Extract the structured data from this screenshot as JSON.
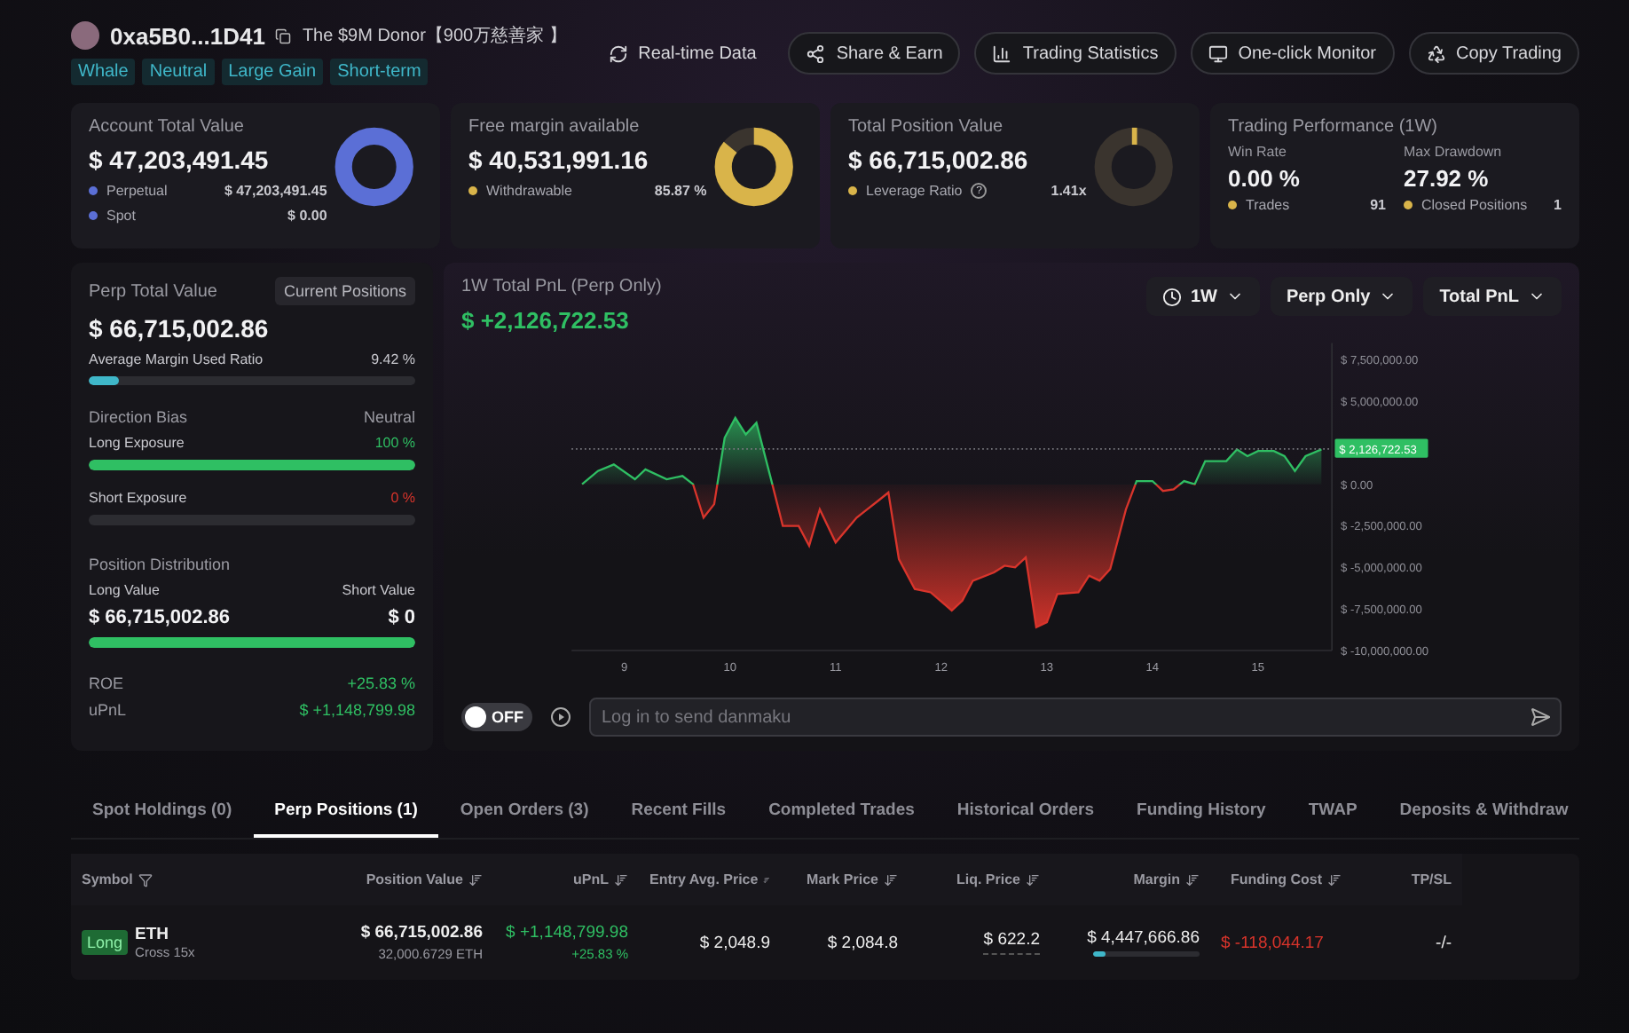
{
  "header": {
    "address": "0xa5B0...1D41",
    "nickname": "The $9M Donor【900万慈善家 】",
    "tags": [
      "Whale",
      "Neutral",
      "Large Gain",
      "Short-term"
    ],
    "actions": [
      {
        "label": "Real-time Data",
        "kind": "refresh",
        "framed": false
      },
      {
        "label": "Share & Earn",
        "kind": "share",
        "framed": true
      },
      {
        "label": "Trading Statistics",
        "kind": "stats",
        "framed": true
      },
      {
        "label": "One-click Monitor",
        "kind": "monitor",
        "framed": true
      },
      {
        "label": "Copy Trading",
        "kind": "copy",
        "framed": true
      }
    ]
  },
  "summary_cards": [
    {
      "kind": "donut",
      "title": "Account Total Value",
      "value": "$ 47,203,491.45",
      "color": "#5b6fd6",
      "rows": [
        {
          "label": "Perpetual",
          "value": "$ 47,203,491.45",
          "color": "#5b6fd6"
        },
        {
          "label": "Spot",
          "value": "$ 0.00",
          "color": "#5b6fd6"
        }
      ]
    },
    {
      "kind": "donut",
      "title": "Free margin available",
      "value": "$ 40,531,991.16",
      "color": "#d9b44a",
      "level": 0.8587,
      "rows": [
        {
          "label": "Withdrawable",
          "value": "85.87 %",
          "color": "#d9b44a"
        }
      ]
    },
    {
      "kind": "gauge",
      "title": "Total Position Value",
      "value": "$ 66,715,002.86",
      "color": "#d9b44a",
      "rows": [
        {
          "label": "Leverage Ratio",
          "value": "1.41x",
          "color": "#d9b44a",
          "help": "?"
        }
      ]
    },
    {
      "kind": "performance",
      "title": "Trading Performance (1W)",
      "stats": [
        {
          "label": "Win Rate",
          "value": "0.00 %"
        },
        {
          "label": "Max Drawdown",
          "value": "27.92 %"
        }
      ],
      "rows": [
        {
          "label": "Trades",
          "value": "91",
          "color": "#d9b44a"
        },
        {
          "label": "Closed Positions",
          "value": "1",
          "color": "#d9b44a"
        }
      ]
    }
  ],
  "perp_panel": {
    "title": "Perp Total Value",
    "button": "Current Positions",
    "value": "$ 66,715,002.86",
    "margin": {
      "label": "Average Margin Used Ratio",
      "reading": "9.42 %",
      "level": 0.0942
    },
    "bias": {
      "title": "Direction Bias",
      "reading": "Neutral",
      "bars": [
        {
          "label": "Long Exposure",
          "reading": "100 %",
          "level": 1,
          "color": "#2fbf63"
        },
        {
          "label": "Short Exposure",
          "reading": "0 %",
          "color": "#d9342b"
        }
      ]
    },
    "distribution": {
      "title": "Position Distribution",
      "long_label": "Long Value",
      "short_label": "Short Value",
      "long_value": "$ 66,715,002.86",
      "short_value": "$ 0",
      "level": 1
    },
    "metrics": [
      {
        "label": "ROE",
        "value": "+25.83 %"
      },
      {
        "label": "uPnL",
        "value": "$ +1,148,799.98"
      }
    ]
  },
  "pnl_panel": {
    "title": "1W Total PnL (Perp Only)",
    "value": "$ +2,126,722.53",
    "filters": [
      {
        "label": "1W",
        "icon": true
      },
      {
        "label": "Perp Only",
        "icon": false
      },
      {
        "label": "Total PnL",
        "icon": false
      }
    ],
    "chart_data": {
      "type": "area",
      "ref_lines": [
        {
          "axis": "y",
          "value": 2126722.53,
          "label": "$ 2,126,722.53",
          "color": "#7a7a80"
        }
      ],
      "xlim": [
        8.5,
        15.7
      ],
      "ylim": [
        -10000000,
        8500000
      ],
      "xticks": [
        9,
        10,
        11,
        12,
        13,
        14,
        15
      ],
      "yticks": [
        {
          "value": 7500000,
          "label": "$ 7,500,000.00"
        },
        {
          "value": 5000000,
          "label": "$ 5,000,000.00"
        },
        {
          "value": 0,
          "label": "$ 0.00"
        },
        {
          "value": -2500000,
          "label": "$ -2,500,000.00"
        },
        {
          "value": -5000000,
          "label": "$ -5,000,000.00"
        },
        {
          "value": -7500000,
          "label": "$ -7,500,000.00"
        },
        {
          "value": -10000000,
          "label": "$ -10,000,000.00"
        }
      ],
      "x": [
        8.6,
        8.75,
        8.9,
        9.1,
        9.2,
        9.4,
        9.55,
        9.65,
        9.75,
        9.85,
        9.95,
        10.05,
        10.15,
        10.25,
        10.4,
        10.5,
        10.65,
        10.75,
        10.85,
        11.0,
        11.2,
        11.3,
        11.4,
        11.5,
        11.6,
        11.75,
        11.9,
        12.1,
        12.2,
        12.3,
        12.5,
        12.6,
        12.7,
        12.8,
        12.9,
        13.0,
        13.1,
        13.3,
        13.4,
        13.5,
        13.6,
        13.75,
        13.85,
        14.0,
        14.1,
        14.2,
        14.3,
        14.4,
        14.5,
        14.7,
        14.8,
        14.9,
        15.0,
        15.15,
        15.25,
        15.35,
        15.45,
        15.6
      ],
      "series": [
        {
          "color": "#2fbf63",
          "values": [
            0,
            800000,
            1200000,
            300000,
            900000,
            300000,
            500000,
            0,
            -2000000,
            -1200000,
            2800000,
            4000000,
            3000000,
            3700000,
            0,
            -2500000,
            -2500000,
            -3700000,
            -1500000,
            -3500000,
            -2000000,
            -1500000,
            -1000000,
            -500000,
            -4500000,
            -6300000,
            -6500000,
            -7600000,
            -7000000,
            -5800000,
            -5300000,
            -4900000,
            -5000000,
            -4400000,
            -8600000,
            -8300000,
            -6600000,
            -6500000,
            -5500000,
            -5800000,
            -5100000,
            -1500000,
            200000,
            200000,
            -400000,
            -300000,
            200000,
            0,
            1400000,
            1400000,
            2100000,
            1700000,
            2000000,
            2000000,
            1700000,
            800000,
            1700000,
            2100000
          ]
        }
      ]
    },
    "danmaku": {
      "on": false,
      "toggle_label": "OFF",
      "placeholder": "Log in to send danmaku"
    }
  },
  "tabs": [
    {
      "label": "Spot Holdings (0)",
      "selected": false
    },
    {
      "label": "Perp Positions (1)",
      "selected": true
    },
    {
      "label": "Open Orders (3)",
      "selected": false
    },
    {
      "label": "Recent Fills",
      "selected": false
    },
    {
      "label": "Completed Trades",
      "selected": false
    },
    {
      "label": "Historical Orders",
      "selected": false
    },
    {
      "label": "Funding History",
      "selected": false
    },
    {
      "label": "TWAP",
      "selected": false
    },
    {
      "label": "Deposits & Withdraw",
      "selected": false
    }
  ],
  "table": {
    "columns": [
      {
        "label": "Symbol",
        "kind": "filter"
      },
      {
        "label": "Position Value",
        "kind": "sort"
      },
      {
        "label": "uPnL",
        "kind": "sort"
      },
      {
        "label": "Entry Avg. Price",
        "kind": "sort"
      },
      {
        "label": "Mark Price",
        "kind": "sort"
      },
      {
        "label": "Liq. Price",
        "kind": "sort"
      },
      {
        "label": "Margin",
        "kind": "sort"
      },
      {
        "label": "Funding Cost",
        "kind": "sort"
      },
      {
        "label": "TP/SL",
        "kind": "plain"
      }
    ],
    "rows": [
      {
        "side": "Long",
        "symbol": "ETH",
        "mode": "Cross 15x",
        "position_value": "$ 66,715,002.86",
        "position_size": "32,000.6729 ETH",
        "upnl": "$ +1,148,799.98",
        "upnl_pct": "+25.83 %",
        "entry": "$ 2,048.9",
        "mark": "$ 2,084.8",
        "liq": "$ 622.2",
        "margin": "$ 4,447,666.86",
        "margin_bar": {
          "level": 0.12
        },
        "funding": "$ -118,044.17",
        "tpsl": "-/-"
      }
    ]
  }
}
